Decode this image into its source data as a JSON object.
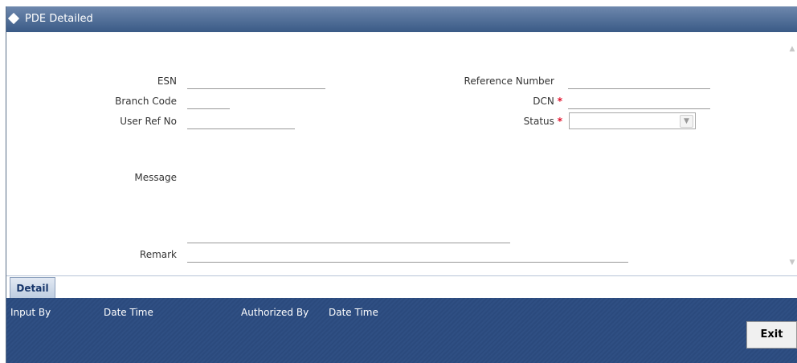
{
  "window": {
    "title": "PDE Detailed"
  },
  "form": {
    "esn_label": "ESN",
    "branch_code_label": "Branch Code",
    "user_ref_label": "User Ref No",
    "reference_number_label": "Reference Number",
    "dcn_label": "DCN",
    "status_label": "Status",
    "message_label": "Message",
    "remark_label": "Remark",
    "required_marker": "*",
    "status_value": ""
  },
  "tabs": {
    "detail": "Detail"
  },
  "footer": {
    "input_by": "Input By",
    "date_time_1": "Date Time",
    "authorized_by": "Authorized By",
    "date_time_2": "Date Time",
    "exit": "Exit"
  },
  "colors": {
    "title_bar": "#3a5a86",
    "footer": "#2f4f83",
    "required": "#e0102a"
  },
  "icons": {
    "title": "diamond-icon",
    "dropdown": "chevron-down-icon",
    "scroll_up": "scroll-up-icon",
    "scroll_down": "scroll-down-icon"
  }
}
